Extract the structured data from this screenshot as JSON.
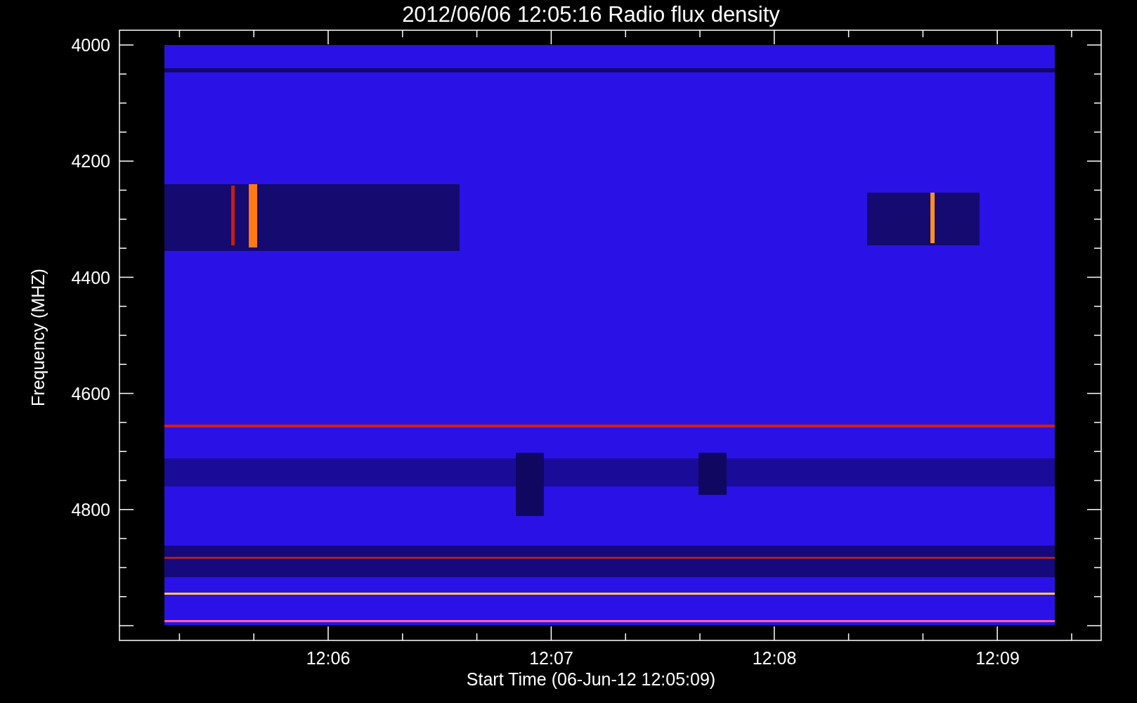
{
  "title": "2012/06/06 12:05:16 Radio flux density",
  "y_axis": {
    "label": "Frequency (MHZ)",
    "ticks": [
      "4000",
      "4200",
      "4400",
      "4600",
      "4800"
    ]
  },
  "x_axis": {
    "label": "Start Time (06-Jun-12 12:05:09)",
    "ticks": [
      "12:06",
      "12:07",
      "12:08",
      "12:09"
    ]
  }
}
